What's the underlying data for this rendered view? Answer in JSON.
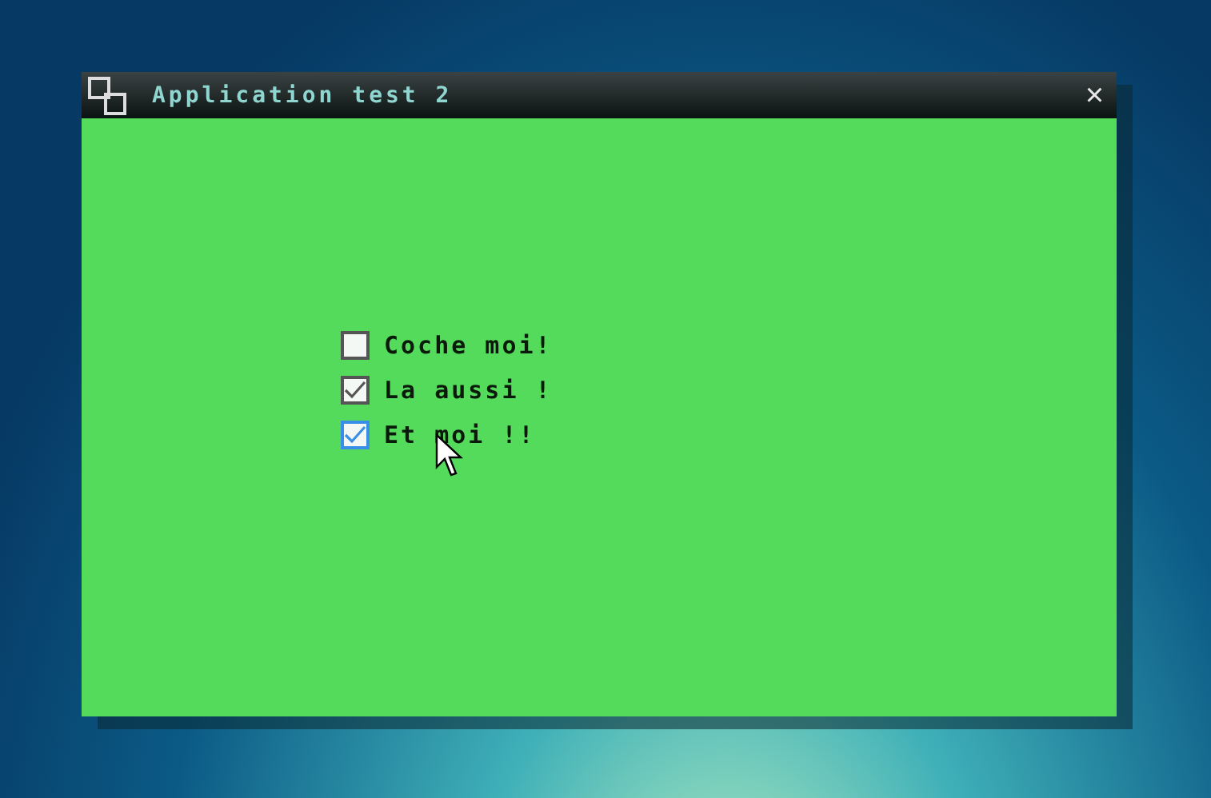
{
  "window": {
    "title": "Application test 2",
    "close": "×"
  },
  "checkboxes": [
    {
      "label": "Coche moi!",
      "checked": false,
      "hovered": false
    },
    {
      "label": "La aussi !",
      "checked": true,
      "hovered": false
    },
    {
      "label": "Et moi !!",
      "checked": true,
      "hovered": true
    }
  ]
}
